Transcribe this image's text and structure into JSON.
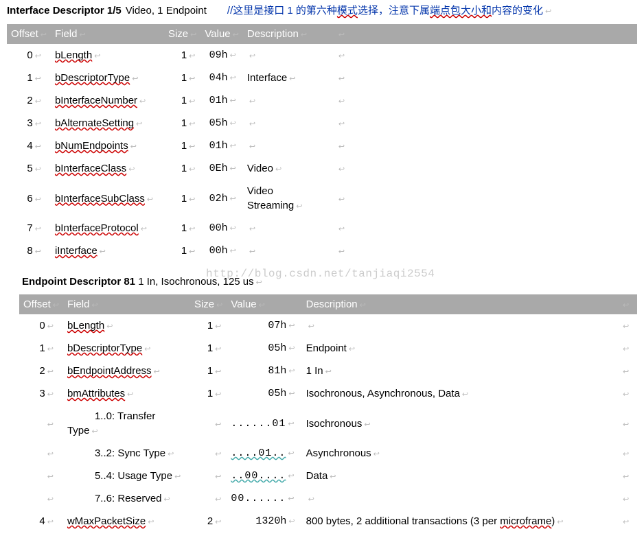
{
  "watermark": "http://blog.csdn.net/tanjiaqi2554",
  "section1": {
    "title": "Interface Descriptor 1/5",
    "sub": "Video, 1 Endpoint",
    "comment_prefix": "//这里是接口 1 的第六种",
    "comment_wavy": "模式",
    "comment_mid": "选择，注意下属",
    "comment_wavy2": "端点包大小和",
    "comment_suffix": "内容的变化",
    "headers": {
      "c0": "Offset",
      "c1": "Field",
      "c2": "Size",
      "c3": "Value",
      "c4": "Description"
    },
    "rows": [
      {
        "o": "0",
        "f": "bLength",
        "s": "1",
        "v": "09h",
        "d": ""
      },
      {
        "o": "1",
        "f": "bDescriptorType",
        "s": "1",
        "v": "04h",
        "d": "Interface"
      },
      {
        "o": "2",
        "f": "bInterfaceNumber",
        "s": "1",
        "v": "01h",
        "d": ""
      },
      {
        "o": "3",
        "f": "bAlternateSetting",
        "s": "1",
        "v": "05h",
        "d": ""
      },
      {
        "o": "4",
        "f": "bNumEndpoints",
        "s": "1",
        "v": "01h",
        "d": ""
      },
      {
        "o": "5",
        "f": "bInterfaceClass",
        "s": "1",
        "v": "0Eh",
        "d": "Video"
      },
      {
        "o": "6",
        "f": "bInterfaceSubClass",
        "s": "1",
        "v": "02h",
        "d": "Video Streaming"
      },
      {
        "o": "7",
        "f": "bInterfaceProtocol",
        "s": "1",
        "v": "00h",
        "d": ""
      },
      {
        "o": "8",
        "f": "iInterface",
        "s": "1",
        "v": "00h",
        "d": ""
      }
    ]
  },
  "section2": {
    "title": "Endpoint Descriptor 81",
    "sub": "1 In, Isochronous, 125 us",
    "headers": {
      "c0": "Offset",
      "c1": "Field",
      "c2": "Size",
      "c3": "Value",
      "c4": "Description"
    },
    "rows": [
      {
        "o": "0",
        "f": "bLength",
        "s": "1",
        "v": "07h",
        "d": "",
        "wavyfld": true
      },
      {
        "o": "1",
        "f": "bDescriptorType",
        "s": "1",
        "v": "05h",
        "d": "Endpoint",
        "wavyfld": true
      },
      {
        "o": "2",
        "f": "bEndpointAddress",
        "s": "1",
        "v": "81h",
        "d": "1 In",
        "wavyfld": true
      },
      {
        "o": "3",
        "f": "bmAttributes",
        "s": "1",
        "v": "05h",
        "d": "Isochronous, Asynchronous, Data",
        "wavyfld": true
      },
      {
        "o": "",
        "f": "1..0: Transfer Type",
        "s": "",
        "v": "......01",
        "d": "Isochronous",
        "indent": true,
        "mono": true
      },
      {
        "o": "",
        "f": "3..2: Sync Type",
        "s": "",
        "v": "....01..",
        "d": "Asynchronous",
        "indent": true,
        "mono": true,
        "dotwavy": true
      },
      {
        "o": "",
        "f": "5..4: Usage Type",
        "s": "",
        "v": "..00....",
        "d": "Data",
        "indent": true,
        "mono": true,
        "dotwavy": true
      },
      {
        "o": "",
        "f": "7..6: Reserved",
        "s": "",
        "v": "00......",
        "d": "",
        "indent": true,
        "mono": true
      },
      {
        "o": "4",
        "f": "wMaxPacketSize",
        "s": "2",
        "v": "1320h",
        "d": "800 bytes, 2 additional transactions (3 per ",
        "dtail": "microframe",
        "dend": ")",
        "wavyfld": true
      }
    ]
  }
}
